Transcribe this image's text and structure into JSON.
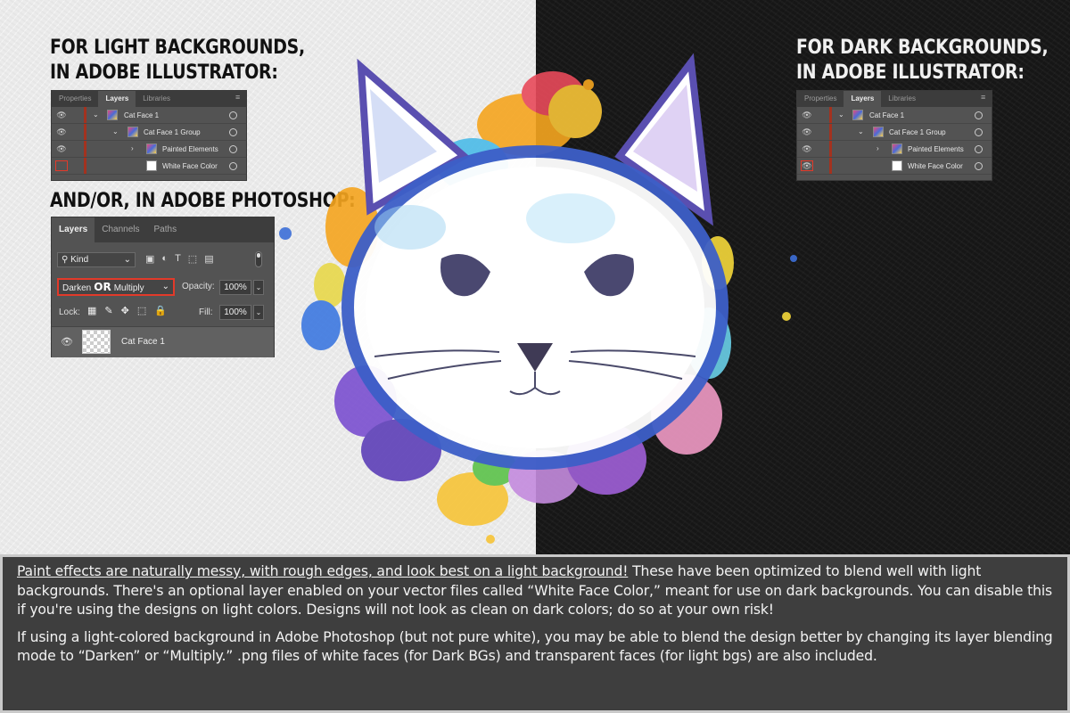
{
  "headings": {
    "light_line1": "FOR LIGHT BACKGROUNDS,",
    "light_line2": "IN ADOBE ILLUSTRATOR:",
    "dark_line1": "FOR DARK BACKGROUNDS,",
    "dark_line2": "IN ADOBE ILLUSTRATOR:",
    "photoshop": "AND/OR, IN ADOBE PHOTOSHOP:"
  },
  "illustrator_panel": {
    "tabs": [
      "Properties",
      "Layers",
      "Libraries"
    ],
    "active_tab": "Layers",
    "layers": [
      "Cat Face 1",
      "Cat Face 1 Group",
      "Painted Elements",
      "White Face Color"
    ]
  },
  "photoshop_panel": {
    "tabs": [
      "Layers",
      "Channels",
      "Paths"
    ],
    "active_tab": "Layers",
    "filter_kind": "Kind",
    "blend_mode_a": "Darken",
    "blend_or": "OR",
    "blend_mode_b": "Multiply",
    "opacity_label": "Opacity:",
    "opacity_value": "100%",
    "lock_label": "Lock:",
    "fill_label": "Fill:",
    "fill_value": "100%",
    "layer_name": "Cat Face 1"
  },
  "info": {
    "p1_underlined": "Paint effects are naturally messy, with rough edges, and look best on a light background!",
    "p1_rest": " These have been optimized to blend well with light backgrounds. There's an optional layer enabled on your vector files called “White Face Color,” meant for use on dark backgrounds. You can disable this if you're using the designs on light colors. Designs will not look as clean on dark colors; do so at your own risk!",
    "p2": "If using a light-colored background in Adobe Photoshop (but not pure white), you may be able to blend the design better by changing its layer blending mode to “Darken” or “Multiply.” .png files of white faces (for Dark BGs) and transparent faces (for light bgs) are also included."
  },
  "colors": {
    "light_bg": "#ebebeb",
    "dark_bg": "#161616",
    "panel_bg": "#535353",
    "highlight_red": "#e23a2a",
    "info_bg": "#3e3e3e"
  }
}
